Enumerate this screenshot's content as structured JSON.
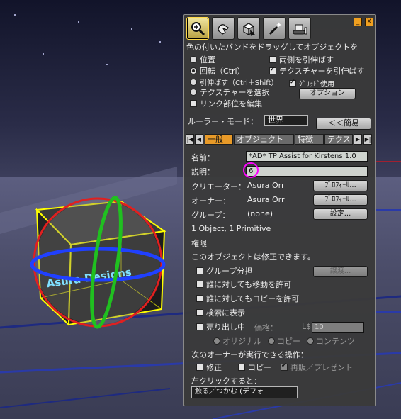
{
  "toolbar": {
    "icons": [
      "zoom-tool-icon",
      "hand-tool-icon",
      "select-tool-icon",
      "magic-wand-icon",
      "bulldozer-icon"
    ],
    "active_index": 0
  },
  "window_buttons": {
    "minimize": "_",
    "close": "X"
  },
  "instructions": "色の付いたバンドをドラッグしてオブジェクトを",
  "modes": {
    "position": "位置",
    "rotate": "回転（Ctrl）",
    "stretch": "引伸ばす（Ctrl＋Shift）",
    "select_texture": "テクスチャーを選択",
    "selected": "rotate"
  },
  "options": {
    "stretch_both": {
      "label": "両側を引伸ばす",
      "checked": false
    },
    "stretch_textures": {
      "label": "テクスチャーを引伸ばす",
      "checked": true
    },
    "use_grid": {
      "label": "ｸﾞﾘｯﾄﾞ使用",
      "checked": true
    },
    "options_button": "オプション"
  },
  "edit_linked": {
    "label": "リンク部位を編集",
    "checked": false
  },
  "ruler": {
    "label": "ルーラー・モード：",
    "value": "世界"
  },
  "less_button": "＜＜簡易",
  "tabs": [
    "一般",
    "オブジェクト",
    "特徴",
    "テクス"
  ],
  "active_tab": 0,
  "general": {
    "name_label": "名前：",
    "name_value": "*AD* TP Assist for Kirstens 1.0",
    "desc_label": "説明：",
    "desc_value": "6",
    "creator_label": "クリエーター：",
    "creator_value": "Asura Orr",
    "owner_label": "オーナー：",
    "owner_value": "Asura Orr",
    "group_label": "グループ：",
    "group_value": "(none)",
    "profile_button": "ﾌﾟﾛﾌｨｰﾙ...",
    "set_button": "設定...",
    "object_count": "1 Object, 1 Primitive",
    "permissions_heading": "権限",
    "modifiable_text": "このオブジェクトは修正できます。",
    "share_group": "グループ分担",
    "deed_button": "譲渡...",
    "allow_move": "誰に対しても移動を許可",
    "allow_copy": "誰に対してもコピーを許可",
    "show_in_search": "検索に表示",
    "for_sale": "売り出し中",
    "price_label": "価格：",
    "price_currency": "L$",
    "price_value": "10",
    "sale_original": "オリジナル",
    "sale_copy": "コピー",
    "sale_contents": "コンテンツ",
    "next_owner_heading": "次のオーナーが実行できる操作：",
    "next_modify": "修正",
    "next_copy": "コピー",
    "next_resell": "再販／プレゼント",
    "left_click_label": "左クリックすると：",
    "left_click_value": "触る／つかむ (デフォ"
  },
  "scene": {
    "object_text": "Asura Designs"
  },
  "colors": {
    "panel": "#3a3a3a",
    "accent": "#e89a28",
    "highlight_ring": "#ff00ff"
  }
}
